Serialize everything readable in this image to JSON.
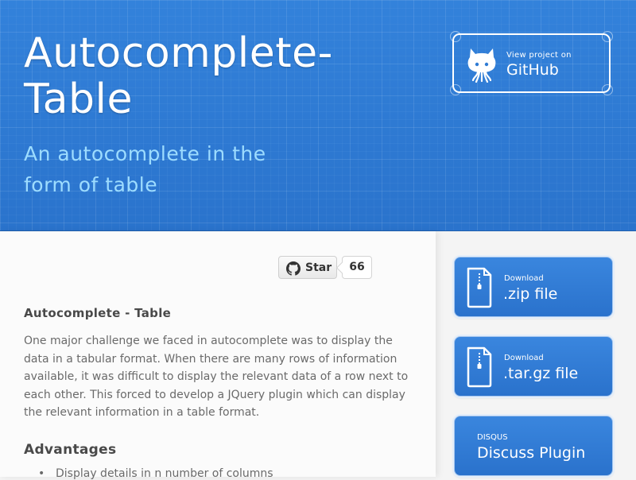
{
  "header": {
    "title": "Autocomplete-Table",
    "subtitle": "An autocomplete in the form of table",
    "github_banner": {
      "small": "View project on",
      "big": "GitHub"
    }
  },
  "star": {
    "label": "Star",
    "count": "66"
  },
  "content": {
    "heading": "Autocomplete - Table",
    "paragraph": "One major challenge we faced in autocomplete was to display the data in a tabular format. When there are many rows of information available, it was difficult to display the relevant data of a row next to each other. This forced to develop a JQuery plugin which can display the relevant information in a table format.",
    "advantages_heading": "Advantages",
    "advantages": [
      "Display details in n number of columns"
    ]
  },
  "sidebar": {
    "zip": {
      "small": "Download",
      "big": ".zip file"
    },
    "tar": {
      "small": "Download",
      "big": ".tar.gz file"
    },
    "disqus": {
      "small": "DISQUS",
      "big": "Discuss Plugin"
    }
  },
  "colors": {
    "header_blue": "#2f7bd4",
    "subtitle": "#9ddcff",
    "button_blue": "#2a72cc"
  }
}
